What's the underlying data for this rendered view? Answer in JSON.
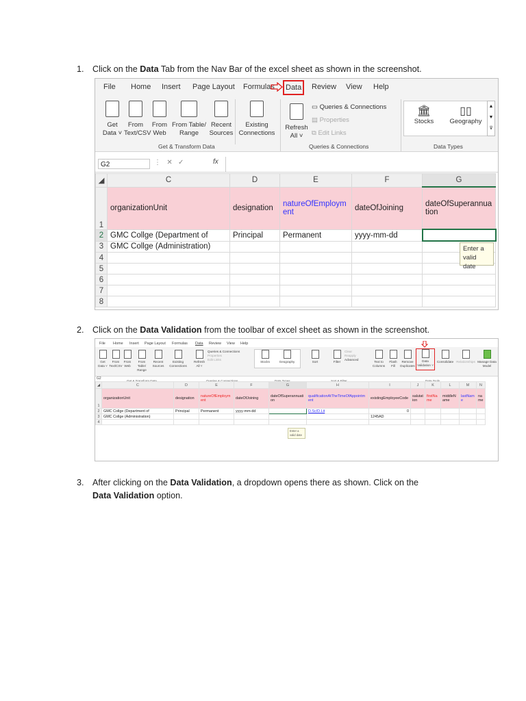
{
  "steps": [
    {
      "num": "1.",
      "pre": "Click on the ",
      "bold": "Data",
      "post": " Tab from the Nav Bar of the excel sheet as shown in the screenshot."
    },
    {
      "num": "2.",
      "pre": "Click on the ",
      "bold": "Data Validation",
      "post": " from the toolbar of excel sheet as shown in the screenshot."
    },
    {
      "num": "3.",
      "pre": "After clicking on the ",
      "bold": "Data Validation",
      "post": ", a dropdown opens there as shown. Click on the",
      "line2_bold": "Data Validation",
      "line2_post": " option."
    }
  ],
  "shot1": {
    "menu": [
      "File",
      "Home",
      "Insert",
      "Page Layout",
      "Formulas",
      "Data",
      "Review",
      "View",
      "Help"
    ],
    "buttons": [
      {
        "l1": "Get",
        "l2": "Data ˅"
      },
      {
        "l1": "From",
        "l2": "Text/CSV"
      },
      {
        "l1": "From",
        "l2": "Web"
      },
      {
        "l1": "From Table/",
        "l2": "Range"
      },
      {
        "l1": "Recent",
        "l2": "Sources"
      },
      {
        "l1": "Existing",
        "l2": "Connections"
      },
      {
        "l1": "Refresh",
        "l2": "All ˅"
      }
    ],
    "queries": [
      "Queries & Connections",
      "Properties",
      "Edit Links"
    ],
    "datatypes": [
      "Stocks",
      "Geography"
    ],
    "groups": [
      "Get & Transform Data",
      "Queries & Connections",
      "Data Types"
    ],
    "namebox": "G2",
    "fx": "fx",
    "cols": [
      "C",
      "D",
      "E",
      "F",
      "G"
    ],
    "rows": [
      "1",
      "2",
      "3",
      "4",
      "5",
      "6",
      "7",
      "8"
    ],
    "header_cells": [
      "organizationUnit",
      "designation",
      "natureOfEmployment",
      "dateOfJoining",
      "dateOfSuperannuation"
    ],
    "row2": [
      "GMC Collge (Department of",
      "Principal",
      "Permanent",
      "yyyy-mm-dd",
      ""
    ],
    "row3": [
      "GMC Collge (Administration)",
      "",
      "",
      "",
      ""
    ],
    "tooltip": [
      "Enter a",
      "valid date"
    ]
  },
  "shot2": {
    "menu": [
      "File",
      "Home",
      "Insert",
      "Page Layout",
      "Formulas",
      "Data",
      "Review",
      "View",
      "Help"
    ],
    "ribbon": [
      "Get Data ˅",
      "From Text/CSV",
      "From Web",
      "From Table/ Range",
      "Recent Sources",
      "Existing Connections",
      "Refresh All ˅",
      "Queries & Connections",
      "Properties",
      "Edit Links",
      "Stocks",
      "Geography",
      "Sort",
      "Filter",
      "Clear",
      "Reapply",
      "Advanced",
      "Text to Columns",
      "Flash Fill",
      "Remove Duplicates",
      "Data Validation ˅",
      "Consolidate",
      "Relationships",
      "Manage Data Model"
    ],
    "groups": [
      "Get & Transform Data",
      "Queries & Connections",
      "Data Types",
      "Sort & Filter",
      "Data Tools"
    ],
    "namebox": "G2",
    "cols": [
      "C",
      "D",
      "E",
      "F",
      "G",
      "H",
      "I",
      "J",
      "K",
      "L",
      "M",
      "N"
    ],
    "rows": [
      "1",
      "2",
      "3",
      "4"
    ],
    "header_cells": [
      "organizationUnit",
      "designation",
      "natureOfEmployment",
      "dateOfJoining",
      "dateOfSuperannuation",
      "qualificationAtTheTimeOfAppointment",
      "existingEmployeeCode",
      "salutation",
      "firstName",
      "middleName",
      "lastName",
      "name"
    ],
    "row2": [
      "GMC Collge (Department of",
      "Principal",
      "Permanent",
      "yyyy-mm-dd",
      "",
      "D.Sc/D.Lit",
      "0",
      "",
      "",
      "",
      "",
      ""
    ],
    "row3": [
      "GMC Collge (Administration)",
      "",
      "",
      "",
      "",
      "",
      "1245AD",
      "",
      "",
      "",
      "",
      ""
    ],
    "tooltip": [
      "Enter a",
      "valid date"
    ]
  },
  "colors": {
    "highlight_red": "#e02020",
    "pink_header": "#f9d0d6",
    "blue_text": "#3333ff"
  }
}
